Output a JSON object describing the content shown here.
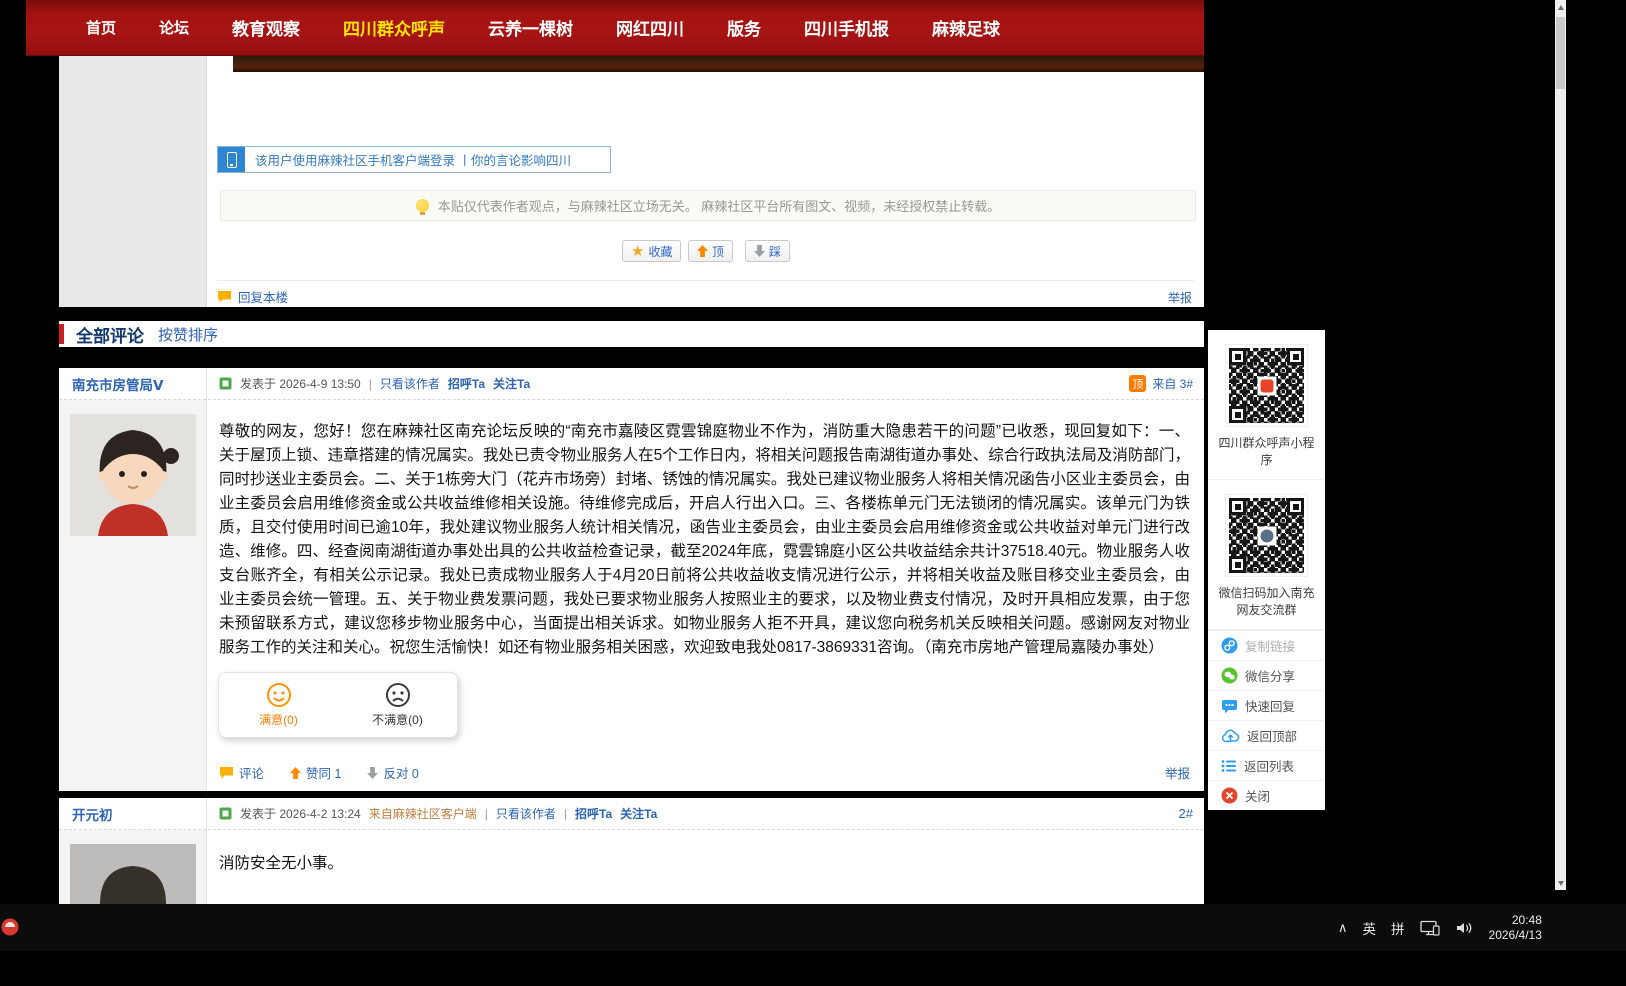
{
  "ui": {
    "pipe": "|"
  },
  "icons": {
    "star": "★",
    "caret": "∧"
  },
  "colors": {
    "nav_red": "#a41212",
    "link_blue": "#2d64b3",
    "active_yellow": "#ffe400"
  },
  "navbar": {
    "items": [
      {
        "label": "首页"
      },
      {
        "label": "论坛"
      },
      {
        "label": "教育观察"
      },
      {
        "label": "四川群众呼声"
      },
      {
        "label": "云养一棵树"
      },
      {
        "label": "网红四川"
      },
      {
        "label": "版务"
      },
      {
        "label": "四川手机报"
      },
      {
        "label": "麻辣足球"
      }
    ]
  },
  "post": {
    "phone_notice": "该用户使用麻辣社区手机客户端登录 丨你的言论影响四川",
    "disclaimer": "本贴仅代表作者观点，与麻辣社区立场无关。 麻辣社区平台所有图文、视频，未经授权禁止转载。",
    "actions": {
      "favorite": "收藏",
      "up": "顶",
      "down": "踩"
    },
    "reply_floor": "回复本楼",
    "report": "举报"
  },
  "comments_header": {
    "title": "全部评论",
    "sort": "按赞排序"
  },
  "comments": [
    {
      "author": "南充市房管局Ⅴ",
      "posted": "发表于 2026-4-9 13:50",
      "only_author": "只看该作者",
      "greet": "招呼Ta",
      "follow": "关注Ta",
      "badge": "顶",
      "from_floor": "来自 3#",
      "body": "尊敬的网友，您好！您在麻辣社区南充论坛反映的“南充市嘉陵区霓雲锦庭物业不作为，消防重大隐患若干的问题”已收悉，现回复如下：一、关于屋顶上锁、违章搭建的情况属实。我处已责令物业服务人在5个工作日内，将相关问题报告南湖街道办事处、综合行政执法局及消防部门，同时抄送业主委员会。二、关于1栋旁大门（花卉市场旁）封堵、锈蚀的情况属实。我处已建议物业服务人将相关情况函告小区业主委员会，由业主委员会启用维修资金或公共收益维修相关设施。待维修完成后，开启人行出入口。三、各楼栋单元门无法锁闭的情况属实。该单元门为铁质，且交付使用时间已逾10年，我处建议物业服务人统计相关情况，函告业主委员会，由业主委员会启用维修资金或公共收益对单元门进行改造、维修。四、经查阅南湖街道办事处出具的公共收益检查记录，截至2024年底，霓雲锦庭小区公共收益结余共计37518.40元。物业服务人收支台账齐全，有相关公示记录。我处已责成物业服务人于4月20日前将公共收益收支情况进行公示，并将相关收益及账目移交业主委员会，由业主委员会统一管理。五、关于物业费发票问题，我处已要求物业服务人按照业主的要求，以及物业费支付情况，及时开具相应发票，由于您未预留联系方式，建议您移步物业服务中心，当面提出相关诉求。如物业服务人拒不开具，建议您向税务机关反映相关问题。感谢网友对物业服务工作的关注和关心。祝您生活愉快！如还有物业服务相关困惑，欢迎致电我处0817-3869331咨询。（南充市房地产管理局嘉陵办事处）",
      "satisfied": "满意(0)",
      "unsatisfied": "不满意(0)",
      "footer": {
        "comment": "评论",
        "agree": "赞同 1",
        "oppose": "反对 0",
        "report": "举报"
      }
    },
    {
      "author": "开元初",
      "posted": "发表于 2026-4-2 13:24",
      "source": "来自麻辣社区客户端",
      "only_author": "只看该作者",
      "greet": "招呼Ta",
      "follow": "关注Ta",
      "floor": "2#",
      "body": "消防安全无小事。"
    }
  ],
  "side_panel": {
    "qr1_caption": "四川群众呼声小程序",
    "qr2_caption": "微信扫码加入南充网友交流群",
    "buttons": [
      "复制链接",
      "微信分享",
      "快速回复",
      "返回顶部",
      "返回列表",
      "关闭"
    ]
  },
  "taskbar": {
    "lang_en": "英",
    "lang_pinyin": "拼",
    "time": "20:48",
    "date": "2026/4/13"
  }
}
